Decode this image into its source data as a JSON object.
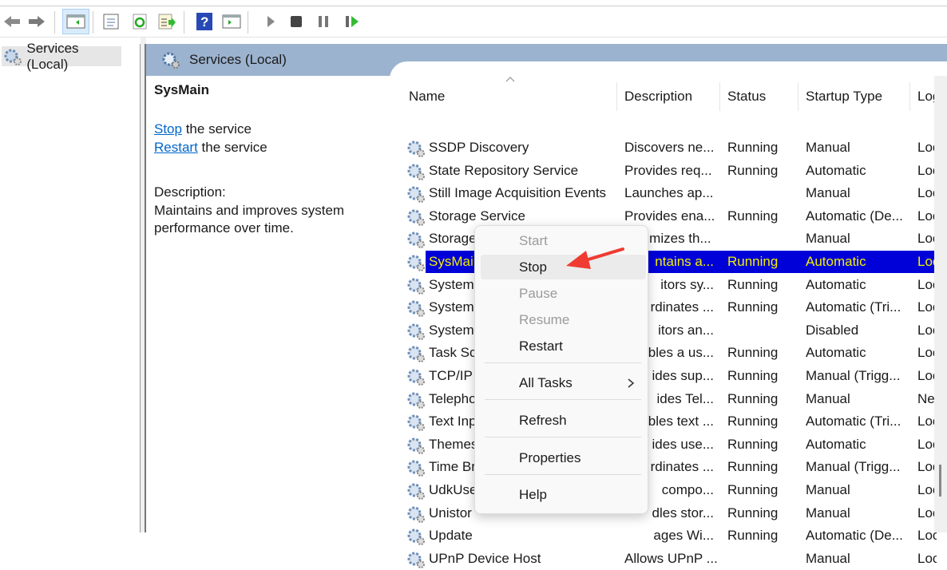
{
  "toolbar": {
    "icons": [
      "back-arrow-icon",
      "forward-arrow-icon",
      "show-hide-console-tree-icon",
      "properties-icon",
      "refresh-icon",
      "export-list-icon",
      "help-icon",
      "show-hide-action-pane-icon",
      "start-service-icon",
      "stop-service-icon",
      "pause-service-icon",
      "resume-service-icon"
    ]
  },
  "tree": {
    "label": "Services (Local)"
  },
  "panel": {
    "title": "Services (Local)"
  },
  "extended": {
    "service_name": "SysMain",
    "stop_link": "Stop",
    "stop_suffix": " the service",
    "restart_link": "Restart",
    "restart_suffix": " the service",
    "desc_label": "Description:",
    "desc_text": "Maintains and improves system performance over time."
  },
  "columns": [
    "Name",
    "Description",
    "Status",
    "Startup Type",
    "Log"
  ],
  "rows": [
    {
      "name": "SSDP Discovery",
      "desc": "Discovers ne...",
      "status": "Running",
      "startup": "Manual",
      "log": "Loc"
    },
    {
      "name": "State Repository Service",
      "desc": "Provides req...",
      "status": "Running",
      "startup": "Automatic",
      "log": "Loc"
    },
    {
      "name": "Still Image Acquisition Events",
      "desc": "Launches ap...",
      "status": "",
      "startup": "Manual",
      "log": "Loc"
    },
    {
      "name": "Storage Service",
      "desc": "Provides ena...",
      "status": "Running",
      "startup": "Automatic (De...",
      "log": "Loc"
    },
    {
      "name": "Storage Tiers Management",
      "desc": "Optimizes th...",
      "status": "",
      "startup": "Manual",
      "log": "Loc"
    },
    {
      "name": "SysMai",
      "desc": "ntains a...",
      "status": "Running",
      "startup": "Automatic",
      "log": "Loc",
      "selected": true
    },
    {
      "name": "System",
      "desc": "itors sy...",
      "status": "Running",
      "startup": "Automatic",
      "log": "Loc"
    },
    {
      "name": "System",
      "desc": "rdinates ...",
      "status": "Running",
      "startup": "Automatic (Tri...",
      "log": "Loc"
    },
    {
      "name": "System",
      "desc": "itors an...",
      "status": "",
      "startup": "Disabled",
      "log": "Loc"
    },
    {
      "name": "Task Sch",
      "desc": "bles a us...",
      "status": "Running",
      "startup": "Automatic",
      "log": "Loc"
    },
    {
      "name": "TCP/IP N",
      "desc": "ides sup...",
      "status": "Running",
      "startup": "Manual (Trigg...",
      "log": "Loc"
    },
    {
      "name": "Telepho",
      "desc": "ides Tel...",
      "status": "Running",
      "startup": "Manual",
      "log": "Ne"
    },
    {
      "name": "Text Inp",
      "desc": "bles text ...",
      "status": "Running",
      "startup": "Automatic (Tri...",
      "log": "Loc"
    },
    {
      "name": "Themes",
      "desc": "ides use...",
      "status": "Running",
      "startup": "Automatic",
      "log": "Loc"
    },
    {
      "name": "Time Br",
      "desc": "rdinates ...",
      "status": "Running",
      "startup": "Manual (Trigg...",
      "log": "Loc"
    },
    {
      "name": "UdkUse",
      "desc": "compo...",
      "status": "Running",
      "startup": "Manual",
      "log": "Loc"
    },
    {
      "name": "Unistor",
      "desc": "dles stor...",
      "status": "Running",
      "startup": "Manual",
      "log": "Loc"
    },
    {
      "name": "Update",
      "desc": "ages Wi...",
      "status": "Running",
      "startup": "Automatic (De...",
      "log": "Loc"
    },
    {
      "name": "UPnP Device Host",
      "desc": "Allows UPnP ...",
      "status": "",
      "startup": "Manual",
      "log": "Loc"
    }
  ],
  "context_menu": {
    "items": [
      {
        "label": "Start",
        "disabled": true
      },
      {
        "label": "Stop",
        "highlighted": true
      },
      {
        "label": "Pause",
        "disabled": true
      },
      {
        "label": "Resume",
        "disabled": true
      },
      {
        "label": "Restart"
      },
      {
        "label": "All Tasks",
        "submenu": true
      },
      {
        "label": "Refresh"
      },
      {
        "label": "Properties"
      },
      {
        "label": "Help"
      }
    ]
  },
  "colors": {
    "selection_bg": "#0000d8",
    "selection_text": "#f4f000",
    "panel_header": "#9cb3cf",
    "link": "#0066cc",
    "annotation_arrow": "#ef3b32"
  }
}
